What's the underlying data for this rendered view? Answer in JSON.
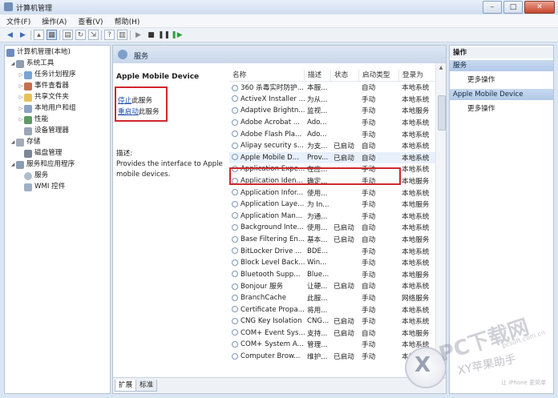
{
  "window": {
    "title": "计算机管理",
    "buttons": {
      "minimize": "–",
      "maximize": "□",
      "close": "✕"
    }
  },
  "menu": [
    "文件(F)",
    "操作(A)",
    "查看(V)",
    "帮助(H)"
  ],
  "tree": {
    "root": "计算机管理(本地)",
    "items": [
      {
        "label": "系统工具",
        "level": 1,
        "expanded": true
      },
      {
        "label": "任务计划程序",
        "level": 2
      },
      {
        "label": "事件查看器",
        "level": 2
      },
      {
        "label": "共享文件夹",
        "level": 2
      },
      {
        "label": "本地用户和组",
        "level": 2
      },
      {
        "label": "性能",
        "level": 2
      },
      {
        "label": "设备管理器",
        "level": 2
      },
      {
        "label": "存储",
        "level": 1,
        "expanded": true
      },
      {
        "label": "磁盘管理",
        "level": 2
      },
      {
        "label": "服务和应用程序",
        "level": 1,
        "expanded": true
      },
      {
        "label": "服务",
        "level": 2
      },
      {
        "label": "WMI 控件",
        "level": 2
      }
    ]
  },
  "services_pane": {
    "header": "服务",
    "selected_name": "Apple Mobile Device",
    "stop_link": "停止",
    "stop_suffix": "此服务",
    "restart_link": "重启动",
    "restart_suffix": "此服务",
    "desc_label": "描述:",
    "desc_text": "Provides the interface to Apple mobile devices.",
    "columns": [
      "名称",
      "描述",
      "状态",
      "启动类型",
      "登录为"
    ],
    "rows": [
      [
        "360 杀毒实时防护...",
        "本服...",
        "",
        "自动",
        "本地系统"
      ],
      [
        "ActiveX Installer ...",
        "为从...",
        "",
        "手动",
        "本地系统"
      ],
      [
        "Adaptive Brightn...",
        "监视...",
        "",
        "手动",
        "本地服务"
      ],
      [
        "Adobe Acrobat ...",
        "Ado...",
        "",
        "手动",
        "本地系统"
      ],
      [
        "Adobe Flash Pla...",
        "Ado...",
        "",
        "手动",
        "本地系统"
      ],
      [
        "Alipay security s...",
        "为支...",
        "已启动",
        "自动",
        "本地系统"
      ],
      [
        "Apple Mobile D...",
        "Prov...",
        "已启动",
        "自动",
        "本地系统"
      ],
      [
        "Application Expe...",
        "在应...",
        "",
        "手动",
        "本地系统"
      ],
      [
        "Application Iden...",
        "确定...",
        "",
        "手动",
        "本地服务"
      ],
      [
        "Application Infor...",
        "使用...",
        "",
        "手动",
        "本地系统"
      ],
      [
        "Application Laye...",
        "为 In...",
        "",
        "手动",
        "本地服务"
      ],
      [
        "Application Man...",
        "为通...",
        "",
        "手动",
        "本地系统"
      ],
      [
        "Background Inte...",
        "使用...",
        "已启动",
        "自动",
        "本地系统"
      ],
      [
        "Base Filtering En...",
        "基本...",
        "已启动",
        "自动",
        "本地服务"
      ],
      [
        "BitLocker Drive ...",
        "BDE...",
        "",
        "手动",
        "本地系统"
      ],
      [
        "Block Level Back...",
        "Win...",
        "",
        "手动",
        "本地系统"
      ],
      [
        "Bluetooth Supp...",
        "Blue...",
        "",
        "手动",
        "本地服务"
      ],
      [
        "Bonjour 服务",
        "让硬...",
        "已启动",
        "自动",
        "本地系统"
      ],
      [
        "BranchCache",
        "此服...",
        "",
        "手动",
        "网络服务"
      ],
      [
        "Certificate Propa...",
        "将用...",
        "",
        "手动",
        "本地系统"
      ],
      [
        "CNG Key Isolation",
        "CNG...",
        "已启动",
        "手动",
        "本地系统"
      ],
      [
        "COM+ Event Sys...",
        "支持...",
        "已启动",
        "自动",
        "本地服务"
      ],
      [
        "COM+ System A...",
        "管理...",
        "",
        "手动",
        "本地系统"
      ],
      [
        "Computer Brow...",
        "维护...",
        "已启动",
        "手动",
        "本地系统"
      ]
    ],
    "tabs": [
      "扩展",
      "标准"
    ]
  },
  "actions": {
    "header": "操作",
    "sections": [
      {
        "title": "服务",
        "items": [
          "更多操作"
        ]
      },
      {
        "title": "Apple Mobile Device",
        "items": [
          "更多操作"
        ]
      }
    ]
  },
  "watermark": {
    "line1": "PC下载网",
    "line2": "XY苹果助手",
    "site": "pcsoft.com.cn",
    "slogan": "让 iPhone 更简单",
    "logo": "X"
  },
  "colors": {
    "highlight_box": "#d0272d",
    "link": "#1a4fb0"
  }
}
